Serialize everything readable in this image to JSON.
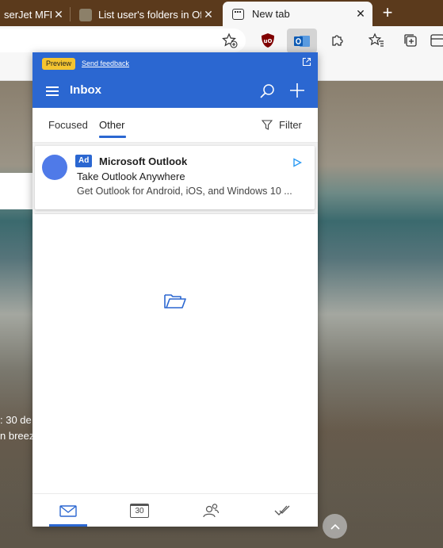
{
  "browser": {
    "tabs": [
      {
        "title": "LaserJet MFP M",
        "visible": "serJet MFP"
      },
      {
        "title": "List user's folders in Offi"
      },
      {
        "title": "New tab"
      }
    ],
    "close_glyph": "✕",
    "newtab_glyph": "+"
  },
  "background": {
    "weather_line1": ": 30 de",
    "weather_line2": "n breez"
  },
  "outlook": {
    "preview_label": "Preview",
    "feedback_label": "Send feedback",
    "inbox_title": "Inbox",
    "tabs": [
      {
        "label": "Focused",
        "active": false
      },
      {
        "label": "Other",
        "active": true
      }
    ],
    "filter_label": "Filter",
    "ad": {
      "badge": "Ad",
      "sender": "Microsoft Outlook",
      "subject": "Take Outlook Anywhere",
      "preview": "Get Outlook for Android, iOS, and Windows 10 ..."
    },
    "nav": {
      "calendar_day": "30",
      "active": "mail"
    },
    "colors": {
      "accent": "#2b67d1",
      "preview_badge": "#f4c430",
      "avatar": "#4f7ae8"
    }
  }
}
